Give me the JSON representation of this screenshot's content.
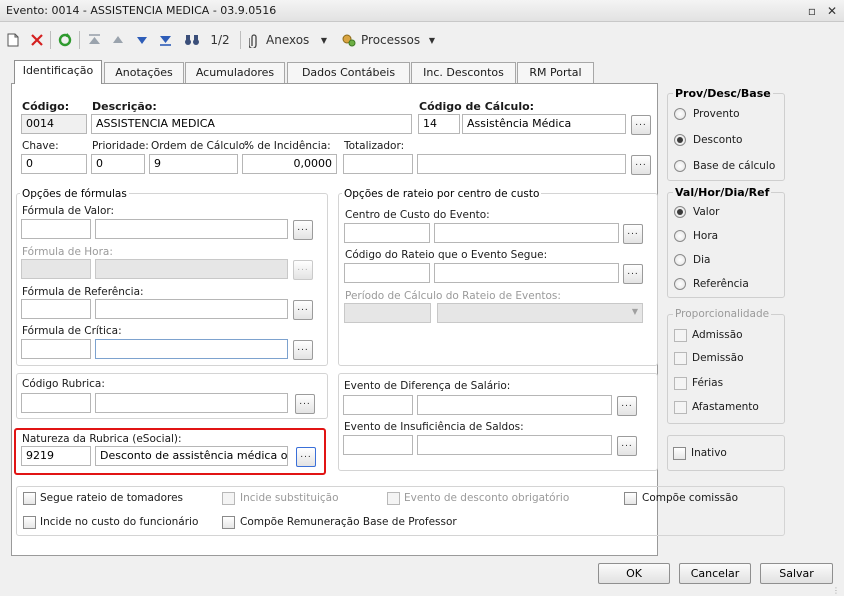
{
  "window": {
    "title": "Evento: 0014 - ASSISTENCIA MEDICA - 03.9.0516"
  },
  "toolbar": {
    "page": "1/2",
    "anexos": "Anexos",
    "processos": "Processos"
  },
  "tabs": [
    "Identificação",
    "Anotações",
    "Acumuladores",
    "Dados Contábeis",
    "Inc. Descontos",
    "RM Portal"
  ],
  "form": {
    "codigo_label": "Código:",
    "codigo_value": "0014",
    "descricao_label": "Descrição:",
    "descricao_value": "ASSISTENCIA MEDICA",
    "codcalc_label": "Código de Cálculo:",
    "codcalc_value": "14",
    "codcalc_desc": "Assistência Médica",
    "chave_label": "Chave:",
    "chave_value": "0",
    "prioridade_label": "Prioridade:",
    "prioridade_value": "0",
    "ordem_label": "Ordem de Cálculo:",
    "ordem_value": "9",
    "incidencia_label": "% de Incidência:",
    "incidencia_value": "0,0000",
    "totalizador_label": "Totalizador:"
  },
  "formulas": {
    "title": "Opções de fórmulas",
    "valor": "Fórmula de Valor:",
    "hora": "Fórmula de Hora:",
    "referencia": "Fórmula de Referência:",
    "critica": "Fórmula de Crítica:"
  },
  "rateio": {
    "title": "Opções de rateio por centro de custo",
    "centro": "Centro de Custo do Evento:",
    "codigo": "Código do Rateio que o Evento Segue:",
    "periodo": "Período de Cálculo do Rateio de Eventos:"
  },
  "rubrica": {
    "label": "Código Rubrica:"
  },
  "natureza": {
    "label": "Natureza da Rubrica (eSocial):",
    "code": "9219",
    "desc": "Desconto de assistência médica ou odo"
  },
  "diferenca": {
    "label": "Evento de Diferença de Salário:"
  },
  "insuficiencia": {
    "label": "Evento de Insuficiência de Saldos:"
  },
  "checkboxes": {
    "segue_rateio": "Segue rateio de tomadores",
    "incide_subst": "Incide substituição",
    "evento_desc": "Evento de desconto obrigatório",
    "compoe_comissao": "Compõe comissão",
    "incide_custo": "Incide no custo do funcionário",
    "compoe_remun": "Compõe Remuneração Base de Professor"
  },
  "prov": {
    "title": "Prov/Desc/Base",
    "options": [
      "Provento",
      "Desconto",
      "Base de cálculo"
    ],
    "selected": "Desconto"
  },
  "val": {
    "title": "Val/Hor/Dia/Ref",
    "options": [
      "Valor",
      "Hora",
      "Dia",
      "Referência"
    ],
    "selected": "Valor"
  },
  "proporcionalidade": {
    "title": "Proporcionalidade",
    "options": [
      "Admissão",
      "Demissão",
      "Férias",
      "Afastamento"
    ]
  },
  "inativo": "Inativo",
  "footer": {
    "ok": "OK",
    "cancelar": "Cancelar",
    "salvar": "Salvar"
  },
  "colors": {
    "highlight": "#e11414",
    "accent": "#3a6fd8"
  }
}
